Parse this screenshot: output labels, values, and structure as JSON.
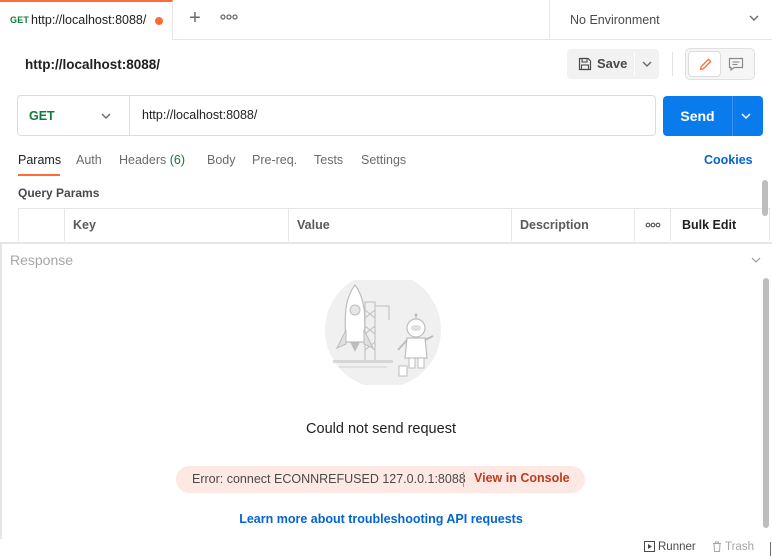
{
  "tabs": [
    {
      "method": "GET",
      "title": "http://localhost:8088/",
      "unsaved": true
    }
  ],
  "tabbar": {
    "add_icon": "plus-icon",
    "more_icon": "ellipsis-icon"
  },
  "environment": {
    "selected": "No Environment"
  },
  "request": {
    "title": "http://localhost:8088/",
    "save_label": "Save",
    "method": "GET",
    "url": "http://localhost:8088/",
    "send_label": "Send"
  },
  "subtabs": [
    {
      "label": "Params",
      "active": true
    },
    {
      "label": "Auth"
    },
    {
      "label": "Headers",
      "count": "(6)"
    },
    {
      "label": "Body"
    },
    {
      "label": "Pre-req."
    },
    {
      "label": "Tests"
    },
    {
      "label": "Settings"
    }
  ],
  "cookies_label": "Cookies",
  "query_params": {
    "title": "Query Params",
    "columns": [
      "Key",
      "Value",
      "Description"
    ],
    "bulk_edit_label": "Bulk Edit"
  },
  "response": {
    "title": "Response",
    "error_title": "Could not send request",
    "error_message": "Error: connect ECONNREFUSED 127.0.0.1:8088",
    "view_console_label": "View in Console",
    "learn_more_label": "Learn more about troubleshooting API requests"
  },
  "footer": {
    "runner_label": "Runner",
    "trash_label": "Trash"
  },
  "colors": {
    "accent_orange": "#ff6c37",
    "send_blue": "#097bed",
    "method_green": "#0f7b3b",
    "link_blue": "#0265d2",
    "error_bg": "#fde8e4",
    "error_link": "#c03b1f"
  }
}
